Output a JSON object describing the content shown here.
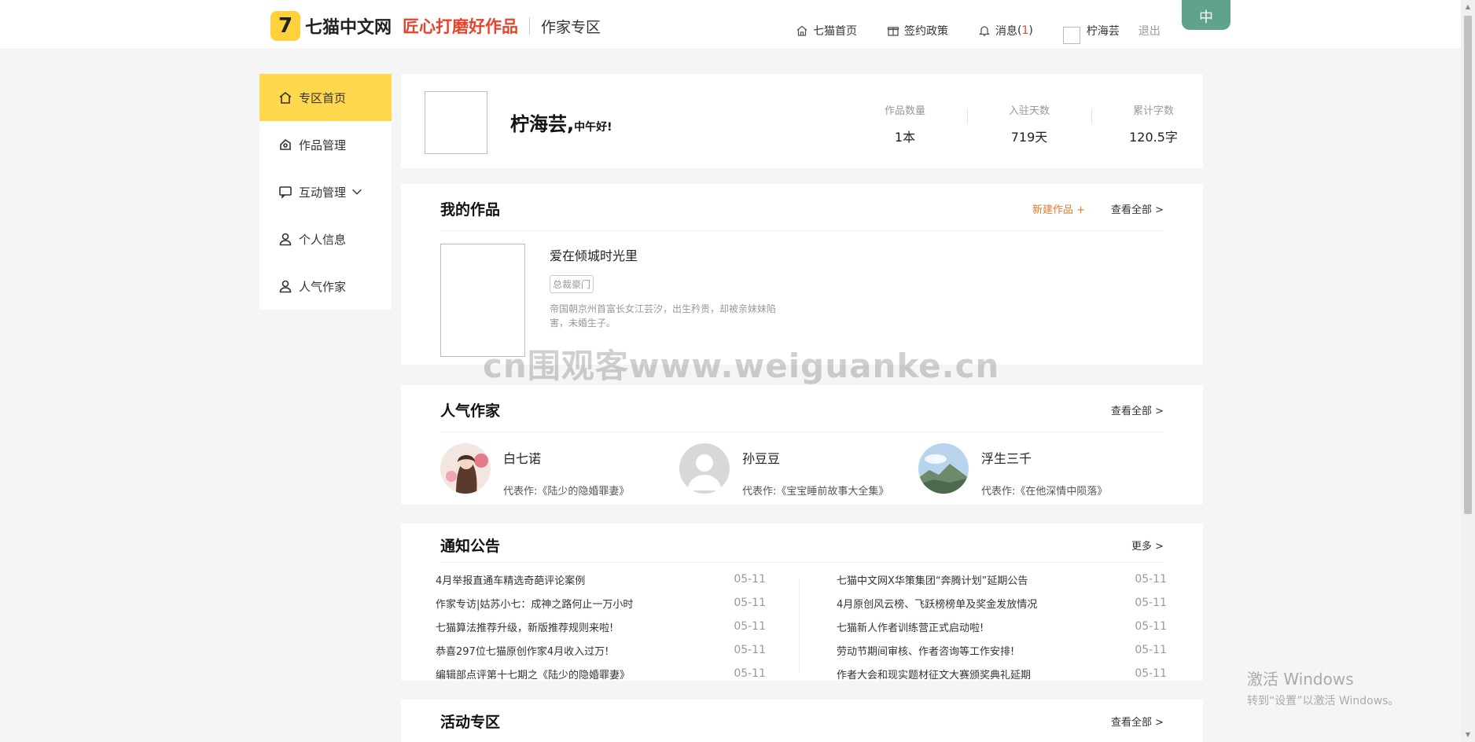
{
  "header": {
    "logo_text": "七猫中文网",
    "slogan": "匠心打磨好作品",
    "zone_title": "作家专区",
    "nav": [
      {
        "label": "七猫首页",
        "icon": "home-icon"
      },
      {
        "label": "签约政策",
        "icon": "gift-icon"
      },
      {
        "label": "消息",
        "icon": "bell-icon"
      }
    ],
    "msg_count_open": "(",
    "msg_count": "1",
    "msg_count_close": ")",
    "username": "柠海芸",
    "logout": "退出",
    "corner_badge": "中"
  },
  "sidebar": {
    "items": [
      {
        "label": "专区首页",
        "icon": "home-icon"
      },
      {
        "label": "作品管理",
        "icon": "tag-icon"
      },
      {
        "label": "互动管理",
        "icon": "chat-icon"
      },
      {
        "label": "个人信息",
        "icon": "user-icon"
      },
      {
        "label": "人气作家",
        "icon": "user-icon"
      }
    ]
  },
  "profile": {
    "name": "柠海芸,",
    "greeting": "中午好!",
    "stats": [
      {
        "label": "作品数量",
        "value": "1本"
      },
      {
        "label": "入驻天数",
        "value": "719天"
      },
      {
        "label": "累计字数",
        "value": "120.5字"
      }
    ]
  },
  "works": {
    "title": "我的作品",
    "new_label": "新建作品 +",
    "view_all": "查看全部 >",
    "item": {
      "title": "爱在倾城时光里",
      "tag": "总裁豪门",
      "desc": "帝国朝京州首富长女江芸汐，出生矜贵，却被亲妹妹陷害，未婚生子。"
    }
  },
  "authors": {
    "title": "人气作家",
    "view_all": "查看全部 >",
    "list": [
      {
        "name": "白七诺",
        "prefix": "代表作:",
        "work": "《陆少的隐婚罪妻》"
      },
      {
        "name": "孙豆豆",
        "prefix": "代表作:",
        "work": "《宝宝睡前故事大全集》"
      },
      {
        "name": "浮生三千",
        "prefix": "代表作:",
        "work": "《在他深情中陨落》"
      }
    ]
  },
  "notices": {
    "title": "通知公告",
    "more": "更多 >",
    "left": [
      {
        "text": "4月举报直通车精选奇葩评论案例",
        "date": "05-11"
      },
      {
        "text": "作家专访|姑苏小七：成神之路何止一万小时",
        "date": "05-11"
      },
      {
        "text": "七猫算法推荐升级，新版推荐规则来啦!",
        "date": "05-11"
      },
      {
        "text": "恭喜297位七猫原创作家4月收入过万!",
        "date": "05-11"
      },
      {
        "text": "编辑部点评第十七期之《陆少的隐婚罪妻》",
        "date": "05-11"
      }
    ],
    "right": [
      {
        "text": "七猫中文网X华策集团“奔腾计划”延期公告",
        "date": "05-11"
      },
      {
        "text": "4月原创风云榜、飞跃榜榜单及奖金发放情况",
        "date": "05-11"
      },
      {
        "text": "七猫新人作者训练营正式启动啦!",
        "date": "05-11"
      },
      {
        "text": "劳动节期间审核、作者咨询等工作安排!",
        "date": "05-11"
      },
      {
        "text": "作者大会和现实题材征文大赛颁奖典礼延期",
        "date": "05-11"
      }
    ]
  },
  "activity": {
    "title": "活动专区",
    "view_all": "查看全部 >"
  },
  "overlay": {
    "watermark": "cn围观客www.weiguanke.cn",
    "win_line1": "激活 Windows",
    "win_line2": "转到“设置”以激活 Windows。"
  }
}
